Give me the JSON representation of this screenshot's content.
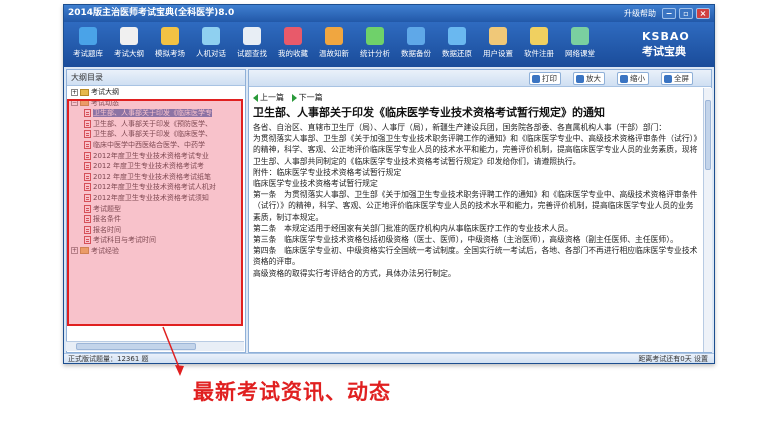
{
  "window": {
    "title": "2014版主治医师考试宝典(全科医学)8.0",
    "help_label": "升级帮助",
    "minimize_label": "−",
    "restore_label": "▫",
    "close_label": "×"
  },
  "toolbar": {
    "items": [
      {
        "label": "考试题库",
        "icon": "book-icon",
        "color": "#4aa3e8"
      },
      {
        "label": "考试大纲",
        "icon": "document-icon",
        "color": "#f0f0f0"
      },
      {
        "label": "模拟考场",
        "icon": "pencil-icon",
        "color": "#f2c244"
      },
      {
        "label": "人机对话",
        "icon": "person-icon",
        "color": "#8fd0f0"
      },
      {
        "label": "试题查找",
        "icon": "search-icon",
        "color": "#e8eef5"
      },
      {
        "label": "我的收藏",
        "icon": "heart-icon",
        "color": "#e85a6a"
      },
      {
        "label": "温故知新",
        "icon": "refresh-icon",
        "color": "#f0a640"
      },
      {
        "label": "统计分析",
        "icon": "chart-icon",
        "color": "#6fd16a"
      },
      {
        "label": "数据备份",
        "icon": "backup-icon",
        "color": "#5fa8e8"
      },
      {
        "label": "数据还原",
        "icon": "restore-icon",
        "color": "#6ab8f0"
      },
      {
        "label": "用户设置",
        "icon": "user-settings-icon",
        "color": "#f0c878"
      },
      {
        "label": "软件注册",
        "icon": "lock-icon",
        "color": "#f0d060"
      },
      {
        "label": "网络课堂",
        "icon": "network-icon",
        "color": "#7ad0a0"
      }
    ],
    "logo_top": "KSBAO",
    "logo_bottom": "考试宝典"
  },
  "left_pane": {
    "header": "大纲目录",
    "tree": [
      {
        "label": "考试大纲",
        "level": 0,
        "kind": "folder",
        "toggle": "+"
      },
      {
        "label": "考试动态",
        "level": 0,
        "kind": "folder",
        "toggle": "−"
      },
      {
        "label": "卫生部、人事部关于印发《临床医学专",
        "level": 1,
        "kind": "doc",
        "selected": true
      },
      {
        "label": "卫生部、人事部关于印发《预防医学、",
        "level": 1,
        "kind": "doc"
      },
      {
        "label": "卫生部、人事部关于印发《临床医学、",
        "level": 1,
        "kind": "doc"
      },
      {
        "label": "临床中医学中西医结合医学、中药学",
        "level": 1,
        "kind": "doc"
      },
      {
        "label": "2012年度卫生专业技术资格考试专业",
        "level": 1,
        "kind": "doc"
      },
      {
        "label": "2012 年度卫生专业技术资格考试考",
        "level": 1,
        "kind": "doc"
      },
      {
        "label": "2012 年度卫生专业技术资格考试纸笔",
        "level": 1,
        "kind": "doc"
      },
      {
        "label": "2012年度卫生专业技术资格考试人机对",
        "level": 1,
        "kind": "doc"
      },
      {
        "label": "2012年度卫生专业技术资格考试须知",
        "level": 1,
        "kind": "doc"
      },
      {
        "label": "考试题型",
        "level": 1,
        "kind": "doc"
      },
      {
        "label": "报名条件",
        "level": 1,
        "kind": "doc"
      },
      {
        "label": "报名时间",
        "level": 1,
        "kind": "doc"
      },
      {
        "label": "考试科目与考试时间",
        "level": 1,
        "kind": "doc"
      },
      {
        "label": "考试经验",
        "level": 0,
        "kind": "folder",
        "toggle": "+"
      }
    ]
  },
  "right_pane": {
    "buttons": [
      {
        "label": "打印",
        "icon": "print-icon"
      },
      {
        "label": "放大",
        "icon": "zoom-in-icon"
      },
      {
        "label": "缩小",
        "icon": "zoom-out-icon"
      },
      {
        "label": "全屏",
        "icon": "fullscreen-icon"
      }
    ],
    "prev_label": "上一篇",
    "next_label": "下一篇",
    "article_title": "卫生部、人事部关于印发《临床医学专业技术资格考试暂行规定》的通知",
    "paragraphs": [
      "各省、自治区、直辖市卫生厅（局）、人事厅（局），新疆生产建设兵团，国务院各部委、各直属机构人事（干部）部门：",
      "为贯彻落实人事部、卫生部《关于加强卫生专业技术职务评聘工作的通知》和《临床医学专业中、高级技术资格评审条件（试行）》的精神，科学、客观、公正地评价临床医学专业人员的技术水平和能力，完善评价机制，提高临床医学专业人员的业务素质，现将卫生部、人事部共同制定的《临床医学专业技术资格考试暂行规定》印发给你们，请遵照执行。",
      "附件：临床医学专业技术资格考试暂行规定",
      "临床医学专业技术资格考试暂行规定",
      "第一条　为贯彻落实人事部、卫生部《关于加强卫生专业技术职务评聘工作的通知》和《临床医学专业中、高级技术资格评审条件（试行）》的精神，科学、客观、公正地评价临床医学专业人员的技术水平和能力，完善评价机制，提高临床医学专业人员的业务素质，制订本规定。",
      "第二条　本规定适用于经国家有关部门批准的医疗机构内从事临床医疗工作的专业技术人员。",
      "第三条　临床医学专业技术资格包括初级资格（医士、医师），中级资格（主治医师），高级资格（副主任医师、主任医师）。",
      "第四条　临床医学专业初、中级资格实行全国统一考试制度。全国实行统一考试后，各地、各部门不再进行相应临床医学专业技术资格的评审。",
      "高级资格的取得实行考评结合的方式，具体办法另行制定。"
    ]
  },
  "statusbar": {
    "left": "正式版试题量：12361 题",
    "right": "距离考试还有0天  设置"
  },
  "annotation": {
    "caption": "最新考试资讯、动态",
    "highlight_color": "#e02020"
  }
}
